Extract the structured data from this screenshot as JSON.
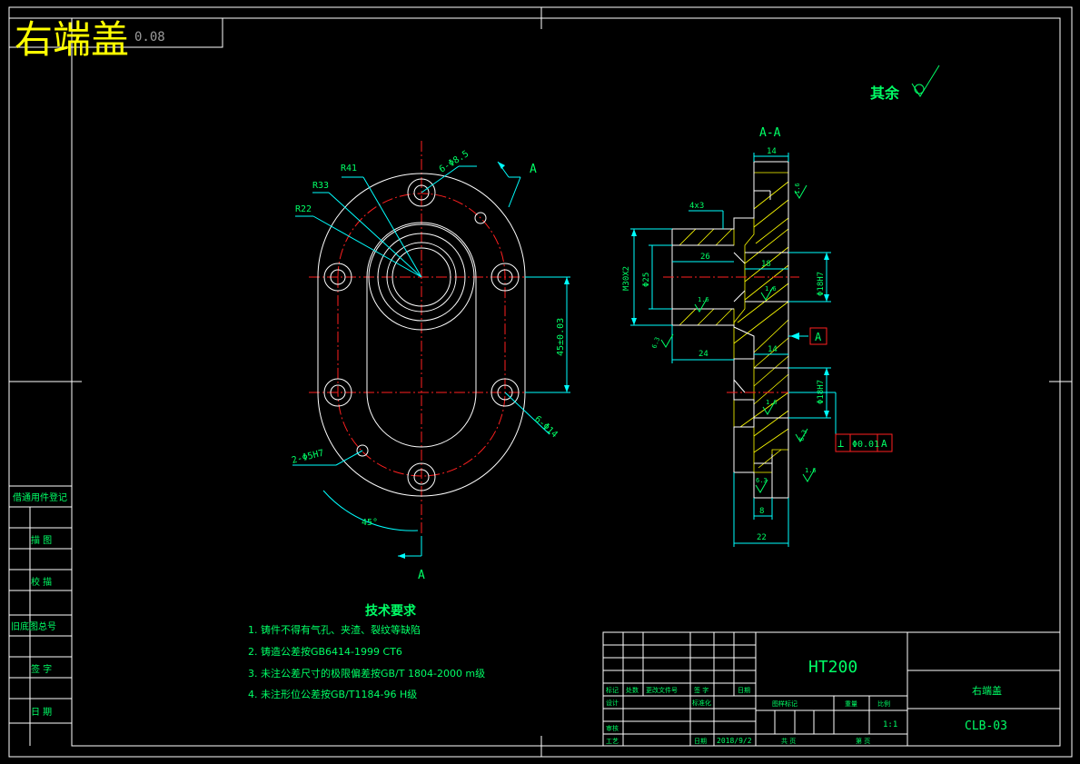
{
  "title_overlay": "右端盖",
  "roughness_note": "其余",
  "colors": {
    "frame": "#ffffff",
    "outline": "#ffffff",
    "center_line": "#ff2020",
    "dimension": "#00ffff",
    "dim_text": "#00ff66",
    "hatch": "#ffff00",
    "title_text": "#ffff00"
  },
  "front_view": {
    "labels": {
      "r41": "R41",
      "r33": "R33",
      "r22": "R22",
      "holes_top": "6-Φ8.5",
      "holes_right": "6-Φ14",
      "pins": "2-Φ5H7",
      "vertical_dim": "45±0.03",
      "angle": "45°",
      "section_top": "A",
      "section_bottom": "A"
    }
  },
  "section_view": {
    "title": "A-A",
    "labels": {
      "d14_top": "14",
      "chamfer": "4x3",
      "d26": "26",
      "d18": "18",
      "thread": "M30X2",
      "d25": "Φ25",
      "bore_upper": "Φ18H7",
      "bore_lower": "Φ18H7",
      "d24": "24",
      "d14_mid": "14",
      "d8": "8",
      "d22": "22",
      "datum": "A",
      "tol_symbol": "⊥",
      "tol_value": "Φ0.01",
      "tol_datum": "A",
      "rough_1": "1.6",
      "rough_2": "6.3",
      "rough_3": "1.6",
      "rough_4": "1.6",
      "rough_5": "6.3",
      "rough_6": "1.6",
      "rough_7": "6.3",
      "rough_8": "1.6"
    }
  },
  "tech_requirements": {
    "heading": "技术要求",
    "items": [
      "1. 铸件不得有气孔、夹渣、裂纹等缺陷",
      "2. 铸造公差按GB6414-1999 CT6",
      "3. 未注公差尺寸的极限偏差按GB/T 1804-2000 m级",
      "4. 未注形位公差按GB/T1184-96 H级"
    ]
  },
  "left_strip": {
    "rows": [
      "借通用件登记",
      "描  图",
      "校  描",
      "旧底图总号",
      "签  字",
      "日  期"
    ]
  },
  "title_block": {
    "material": "HT200",
    "part_name": "右端盖",
    "drawing_no": "CLB-03",
    "scale": "1:1",
    "row_labels": {
      "mark": "标记",
      "count": "处数",
      "file_no": "更改文件号",
      "sign": "签 字",
      "date": "日期",
      "design": "设计",
      "standard": "标准化",
      "review": "审核",
      "process": "工艺",
      "date2": "日期",
      "date_value": "2018/9/2",
      "stage_mark": "图样标记",
      "weight": "重量",
      "scale_label": "比例",
      "total": "共 页",
      "page": "第 页"
    }
  },
  "top_left_box": "0.08"
}
